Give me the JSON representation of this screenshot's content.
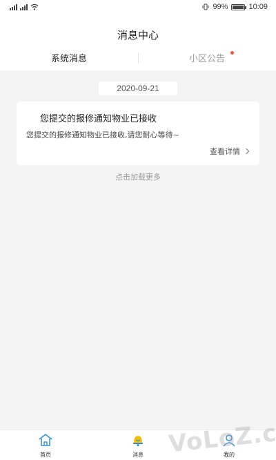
{
  "status_bar": {
    "battery": "99%",
    "battery_level": 0.99,
    "time": "10:09"
  },
  "header": {
    "title": "消息中心",
    "tabs": [
      {
        "label": "系统消息",
        "active": true
      },
      {
        "label": "小区公告",
        "active": false,
        "unread_dot": true
      }
    ]
  },
  "messages": [
    {
      "date": "2020-09-21",
      "title": "您提交的报修通知物业已接收",
      "body": "您提交的报修通知物业已接收,请您耐心等待~",
      "link_label": "查看详情"
    }
  ],
  "load_more_label": "点击加载更多",
  "bottom_nav": [
    {
      "label": "首页",
      "icon": "home-icon"
    },
    {
      "label": "消息",
      "icon": "bell-icon"
    },
    {
      "label": "我的",
      "icon": "person-icon"
    }
  ],
  "watermark": {
    "text": "VoLoZ.com"
  },
  "colors": {
    "accent_dot": "#e8553a",
    "bell": "#f2c300",
    "icon_blue": "#3a8fd8"
  }
}
